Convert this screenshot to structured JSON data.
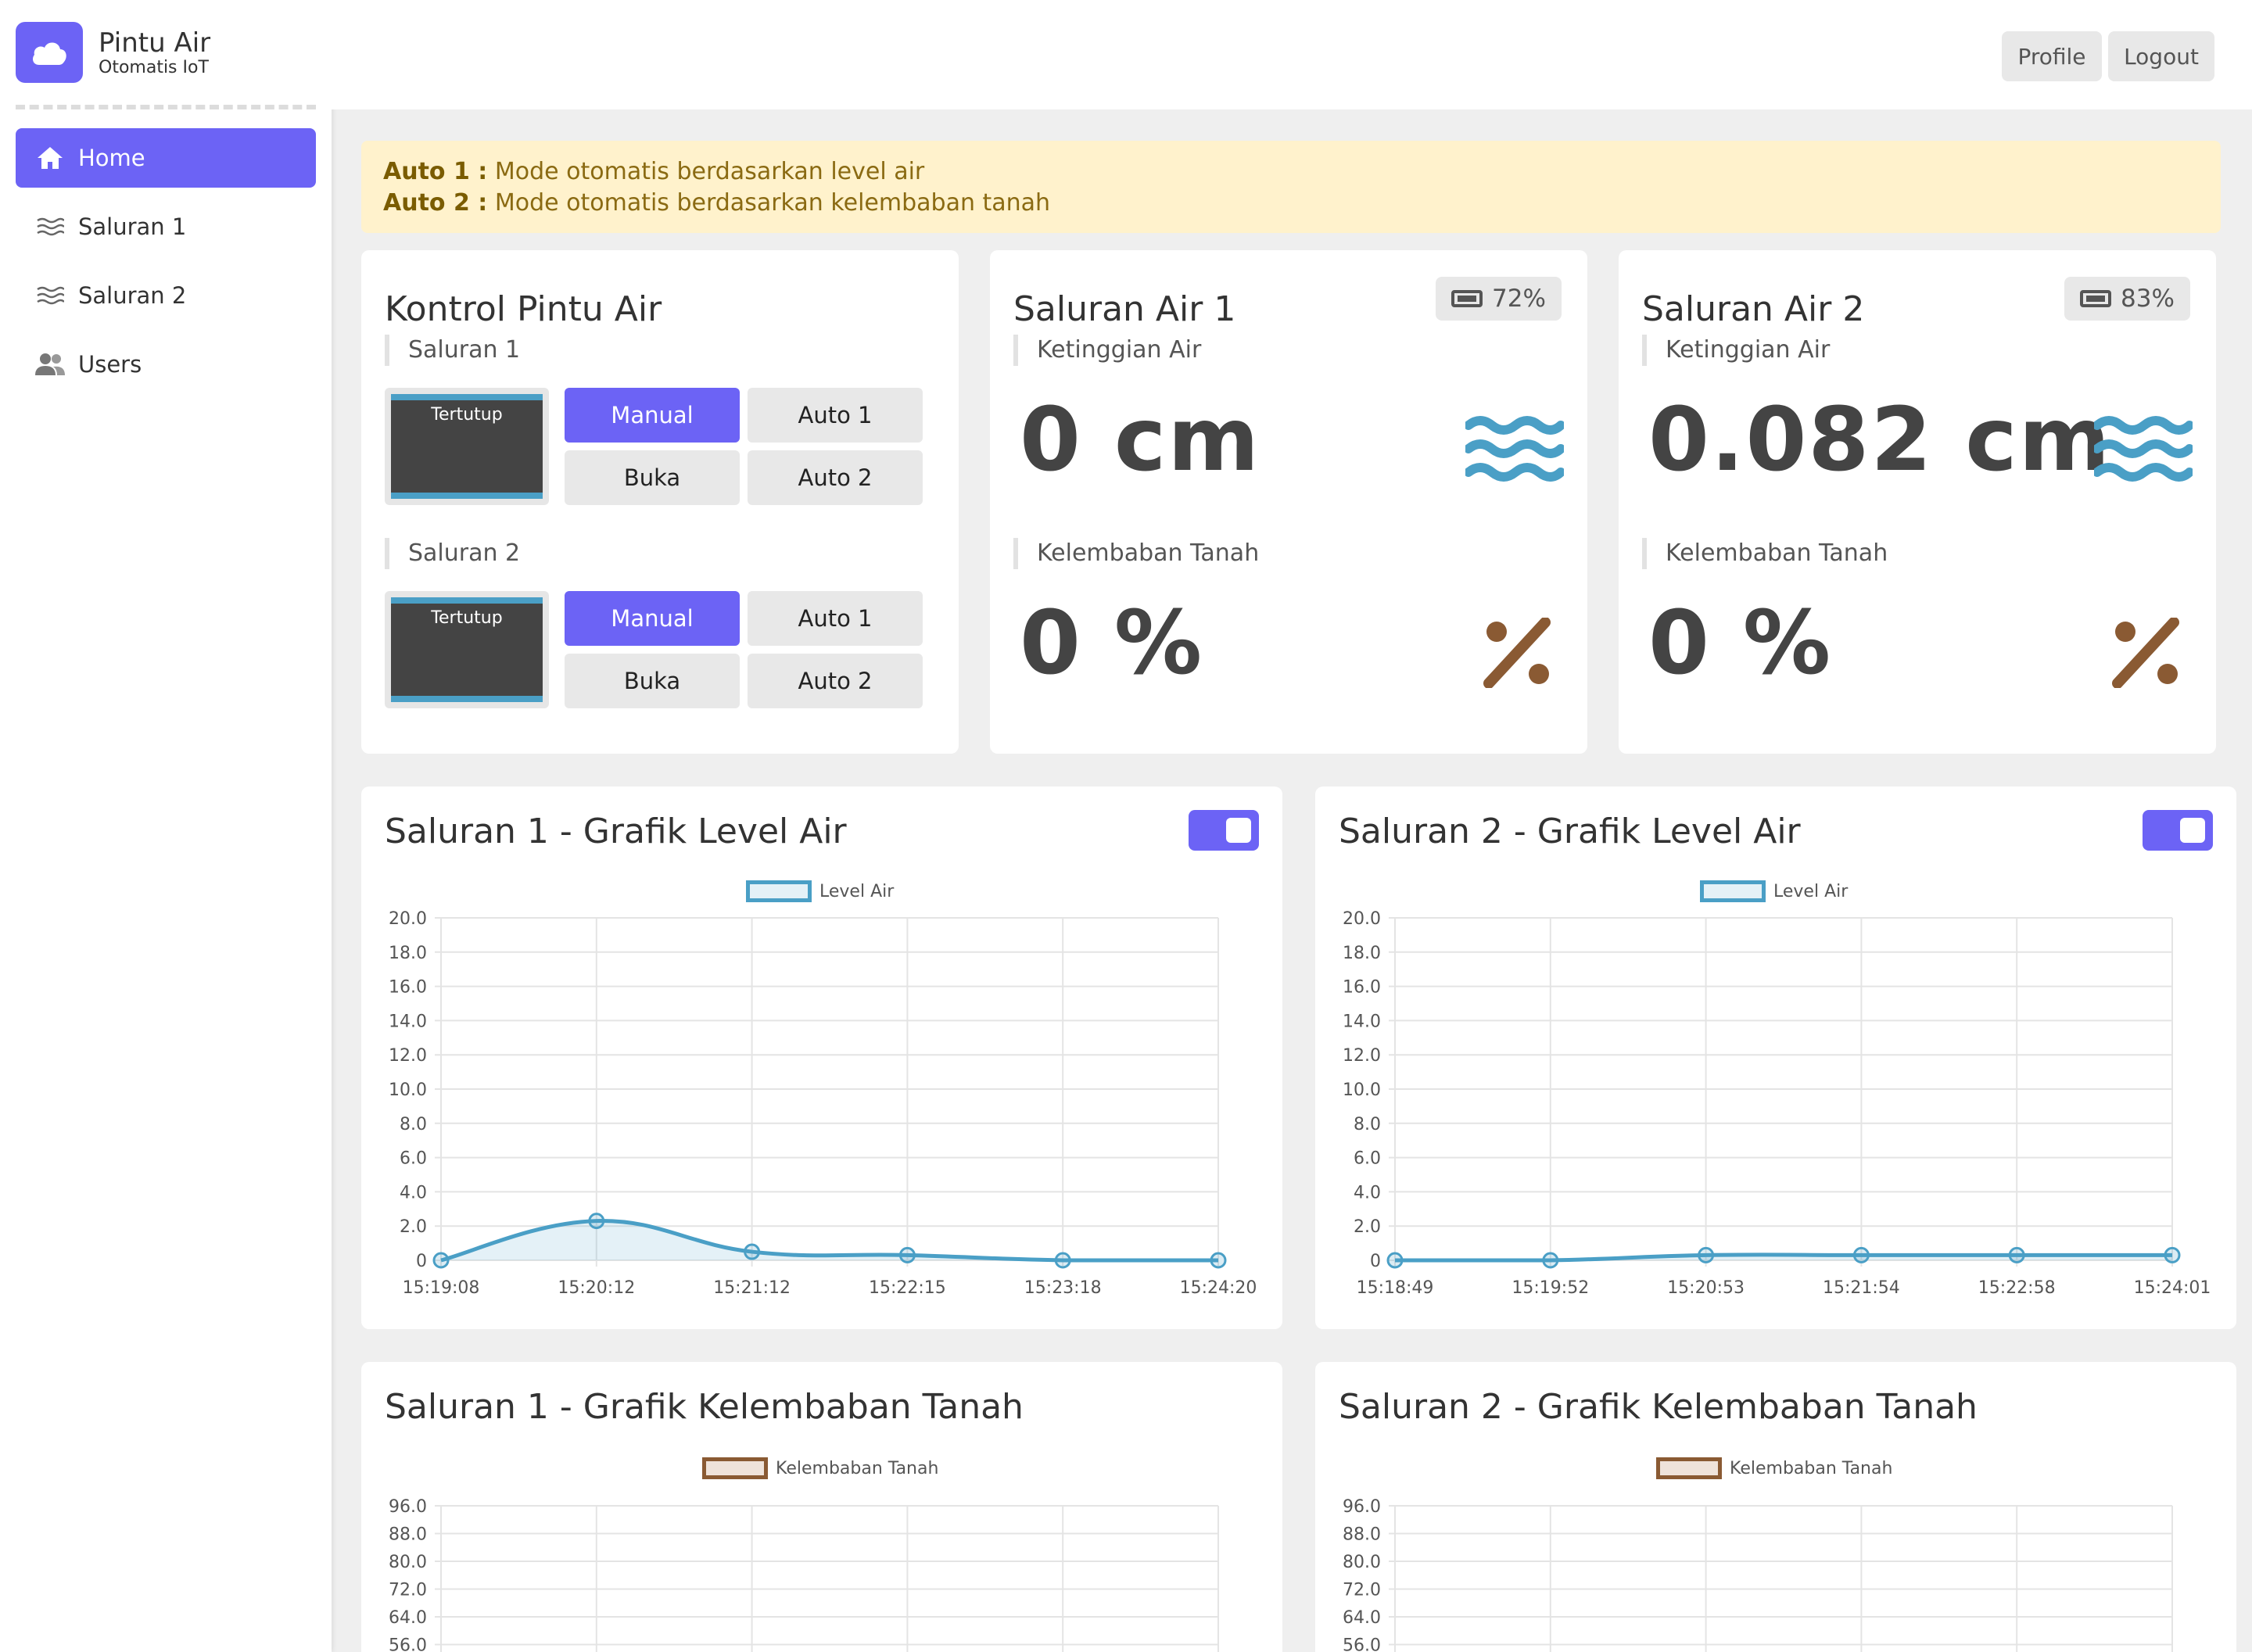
{
  "brand": {
    "title": "Pintu Air",
    "subtitle": "Otomatis IoT"
  },
  "nav": [
    {
      "label": "Home",
      "icon": "home-icon",
      "active": true
    },
    {
      "label": "Saluran 1",
      "icon": "water-lines-icon",
      "active": false
    },
    {
      "label": "Saluran 2",
      "icon": "water-lines-icon",
      "active": false
    },
    {
      "label": "Users",
      "icon": "users-icon",
      "active": false
    }
  ],
  "topbar": {
    "profile_label": "Profile",
    "logout_label": "Logout"
  },
  "alert": {
    "line1_key": "Auto 1 :",
    "line1_text": "Mode otomatis berdasarkan level air",
    "line2_key": "Auto 2 :",
    "line2_text": "Mode otomatis berdasarkan kelembaban tanah"
  },
  "kontrol": {
    "title": "Kontrol Pintu Air",
    "channels": [
      {
        "label": "Saluran 1",
        "door_status": "Tertutup",
        "btn_manual": "Manual",
        "btn_auto1": "Auto 1",
        "btn_buka": "Buka",
        "btn_auto2": "Auto 2"
      },
      {
        "label": "Saluran 2",
        "door_status": "Tertutup",
        "btn_manual": "Manual",
        "btn_auto1": "Auto 1",
        "btn_buka": "Buka",
        "btn_auto2": "Auto 2"
      }
    ]
  },
  "saluran_cards": [
    {
      "title": "Saluran Air 1",
      "battery": "72%",
      "level_label": "Ketinggian Air",
      "level_value": "0 cm",
      "soil_label": "Kelembaban Tanah",
      "soil_value": "0 %"
    },
    {
      "title": "Saluran Air 2",
      "battery": "83%",
      "level_label": "Ketinggian Air",
      "level_value": "0.082 cm",
      "soil_label": "Kelembaban Tanah",
      "soil_value": "0 %"
    }
  ],
  "colors": {
    "accent": "#6c63f5",
    "water": "#4a9fc6",
    "soil": "#8a5a33",
    "alert_bg": "#fff2cc"
  },
  "chart_titles": {
    "level1": "Saluran 1 - Grafik Level Air",
    "level2": "Saluran 2 - Grafik Level Air",
    "soil1": "Saluran 1 - Grafik Kelembaban Tanah",
    "soil2": "Saluran 2 - Grafik Kelembaban Tanah"
  },
  "chart_data": [
    {
      "type": "line",
      "title": "Saluran 1 - Grafik Level Air",
      "series": [
        {
          "name": "Level Air",
          "values": [
            0,
            2.3,
            0.5,
            0.3,
            0,
            0
          ]
        }
      ],
      "x": [
        "15:19:08",
        "15:20:12",
        "15:21:12",
        "15:22:15",
        "15:23:18",
        "15:24:20"
      ],
      "ylim": [
        0,
        20
      ],
      "yticks": [
        "0",
        "2.0",
        "4.0",
        "6.0",
        "8.0",
        "10.0",
        "12.0",
        "14.0",
        "16.0",
        "18.0",
        "20.0"
      ],
      "grid": true,
      "legend": "top"
    },
    {
      "type": "line",
      "title": "Saluran 2 - Grafik Level Air",
      "series": [
        {
          "name": "Level Air",
          "values": [
            0,
            0,
            0.3,
            0.3,
            0.3,
            0.3
          ]
        }
      ],
      "x": [
        "15:18:49",
        "15:19:52",
        "15:20:53",
        "15:21:54",
        "15:22:58",
        "15:24:01"
      ],
      "ylim": [
        0,
        20
      ],
      "yticks": [
        "0",
        "2.0",
        "4.0",
        "6.0",
        "8.0",
        "10.0",
        "12.0",
        "14.0",
        "16.0",
        "18.0",
        "20.0"
      ],
      "grid": true,
      "legend": "top"
    },
    {
      "type": "line",
      "title": "Saluran 1 - Grafik Kelembaban Tanah",
      "series": [
        {
          "name": "Kelembaban Tanah",
          "values": []
        }
      ],
      "yticks": [
        "96.0",
        "88.0",
        "80.0",
        "72.0",
        "64.0",
        "56.0"
      ],
      "grid": true,
      "legend": "top"
    },
    {
      "type": "line",
      "title": "Saluran 2 - Grafik Kelembaban Tanah",
      "series": [
        {
          "name": "Kelembaban Tanah",
          "values": []
        }
      ],
      "yticks": [
        "96.0",
        "88.0",
        "80.0",
        "72.0",
        "64.0",
        "56.0"
      ],
      "grid": true,
      "legend": "top"
    }
  ]
}
